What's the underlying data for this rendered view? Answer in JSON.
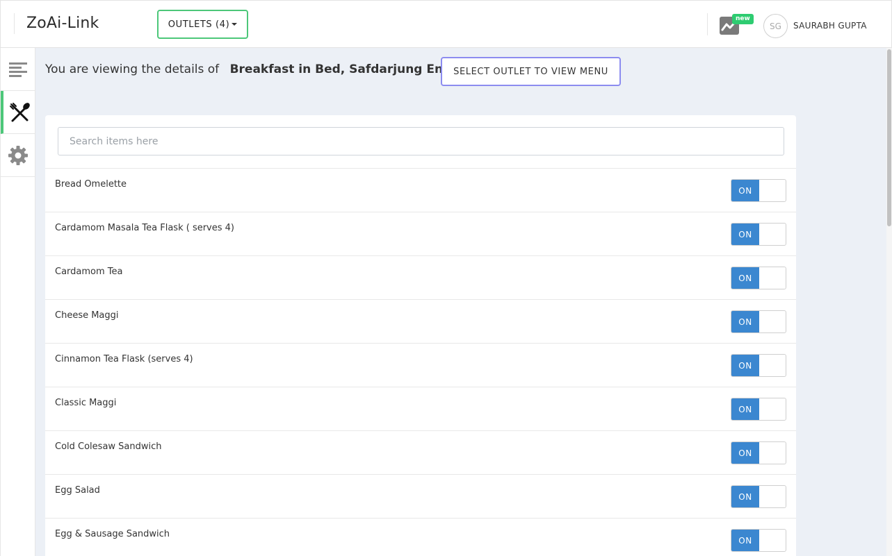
{
  "header": {
    "logo": "ZoAi-Link",
    "outlets_label": "OUTLETS (4)",
    "new_badge": "new",
    "avatar_initials": "SG",
    "user_name": "SAURABH GUPTA"
  },
  "sidebar": {
    "items": [
      {
        "icon": "menu-lines-icon"
      },
      {
        "icon": "fork-knife-icon",
        "active": true
      },
      {
        "icon": "gear-icon"
      }
    ]
  },
  "main": {
    "viewing_prefix": "You are viewing the details of",
    "outlet_name": "Breakfast in Bed, Safdarjung Enclave",
    "select_outlet_label": "SELECT OUTLET TO VIEW MENU",
    "search_placeholder": "Search items here",
    "toggle_label": "ON",
    "items": [
      {
        "name": "Bread Omelette",
        "status": "ON"
      },
      {
        "name": "Cardamom Masala Tea Flask ( serves 4)",
        "status": "ON"
      },
      {
        "name": "Cardamom Tea",
        "status": "ON"
      },
      {
        "name": "Cheese Maggi",
        "status": "ON"
      },
      {
        "name": "Cinnamon Tea Flask (serves 4)",
        "status": "ON"
      },
      {
        "name": "Classic Maggi",
        "status": "ON"
      },
      {
        "name": "Cold Colesaw Sandwich",
        "status": "ON"
      },
      {
        "name": "Egg Salad",
        "status": "ON"
      },
      {
        "name": "Egg & Sausage Sandwich",
        "status": "ON"
      }
    ]
  },
  "colors": {
    "accent_green": "#4cc779",
    "toggle_blue": "#3b87d0",
    "select_border": "#8c8cf0",
    "background": "#ecf0f6"
  }
}
